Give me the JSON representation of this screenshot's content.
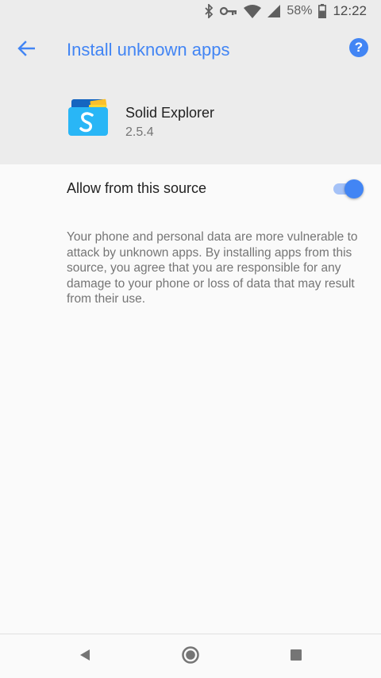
{
  "status_bar": {
    "battery": "58%",
    "time": "12:22"
  },
  "header": {
    "title": "Install unknown apps",
    "back_icon": "arrow-left-icon",
    "help_icon": "help-circle-icon"
  },
  "app": {
    "name": "Solid Explorer",
    "version": "2.5.4",
    "icon": "solid-explorer-app-icon"
  },
  "setting": {
    "label": "Allow from this source",
    "enabled": true
  },
  "warning_text": "Your phone and personal data are more vulnerable to attack by unknown apps. By installing apps from this source, you agree that you are responsible for any damage to your phone or loss of data that may result from their use.",
  "nav_bar": {
    "back_icon": "triangle-back-icon",
    "home_icon": "circle-home-icon",
    "recents_icon": "square-recents-icon"
  },
  "colors": {
    "accent": "#4285f4",
    "header_bg": "#ececec",
    "page_bg": "#fafafa"
  }
}
